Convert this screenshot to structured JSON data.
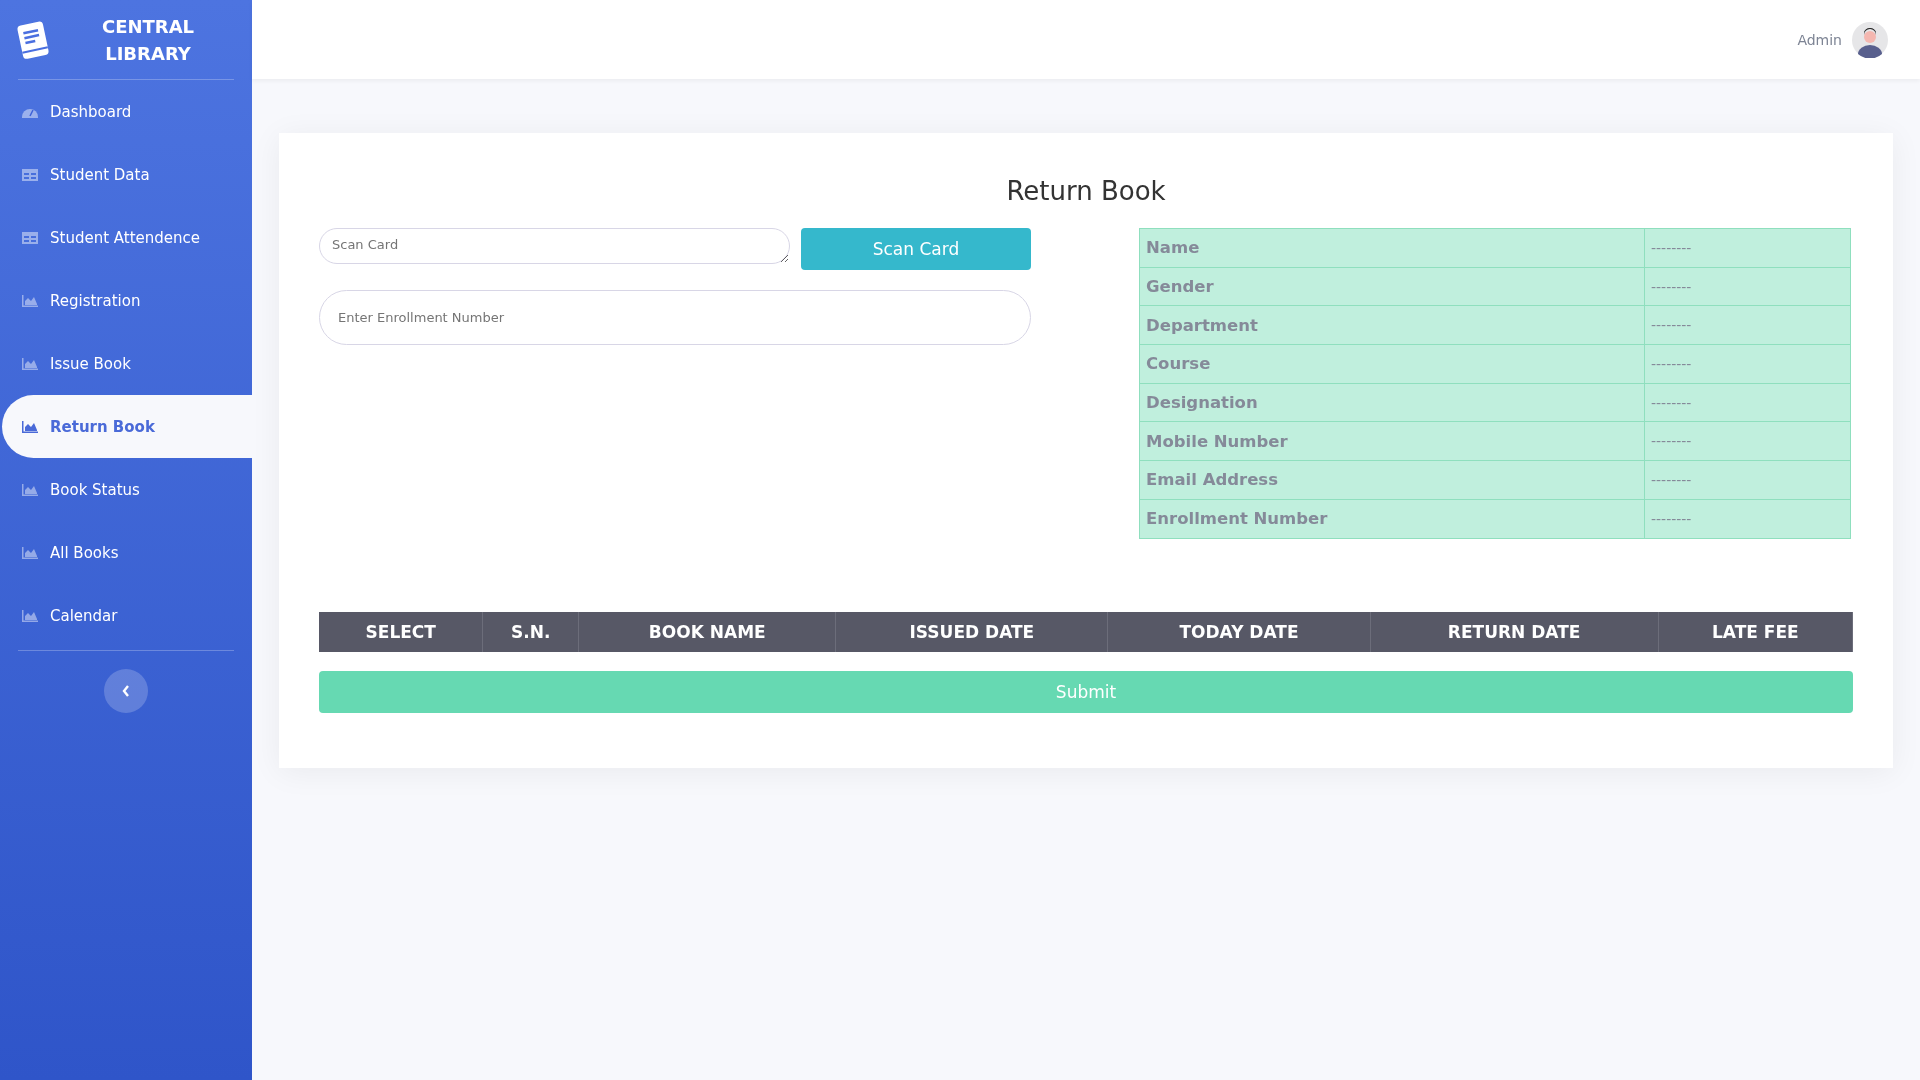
{
  "sidebar": {
    "brand": [
      "CENTRAL",
      "LIBRARY"
    ],
    "items": [
      {
        "label": "Dashboard",
        "kind": "gauge",
        "selected": false
      },
      {
        "label": "Student Data",
        "kind": "table",
        "selected": false
      },
      {
        "label": "Student Attendence",
        "kind": "table",
        "selected": false
      },
      {
        "label": "Registration",
        "kind": "chart",
        "selected": false
      },
      {
        "label": "Issue Book",
        "kind": "chart",
        "selected": false
      },
      {
        "label": "Return Book",
        "kind": "chart",
        "selected": true
      },
      {
        "label": "Book Status",
        "kind": "chart",
        "selected": false
      },
      {
        "label": "All Books",
        "kind": "chart",
        "selected": false
      },
      {
        "label": "Calendar",
        "kind": "chart",
        "selected": false
      }
    ]
  },
  "header": {
    "user": "Admin"
  },
  "form": {
    "title": "Return Book",
    "scan_field": {
      "placeholder": "Scan Card"
    },
    "scan_button": "Scan Card",
    "enrollment_field": {
      "placeholder": "Enter Enrollment Number"
    }
  },
  "details": [
    {
      "label": "Name",
      "value": "--------"
    },
    {
      "label": "Gender",
      "value": "--------"
    },
    {
      "label": "Department",
      "value": "--------"
    },
    {
      "label": "Course",
      "value": "--------"
    },
    {
      "label": "Designation",
      "value": "--------"
    },
    {
      "label": "Mobile Number",
      "value": "--------"
    },
    {
      "label": "Email Address",
      "value": "--------"
    },
    {
      "label": "Enrollment Number",
      "value": "--------"
    }
  ],
  "table": {
    "columns": [
      "SELECT",
      "S.N.",
      "BOOK NAME",
      "ISSUED DATE",
      "TODAY DATE",
      "RETURN DATE",
      "LATE FEE"
    ]
  },
  "submit": "Submit"
}
